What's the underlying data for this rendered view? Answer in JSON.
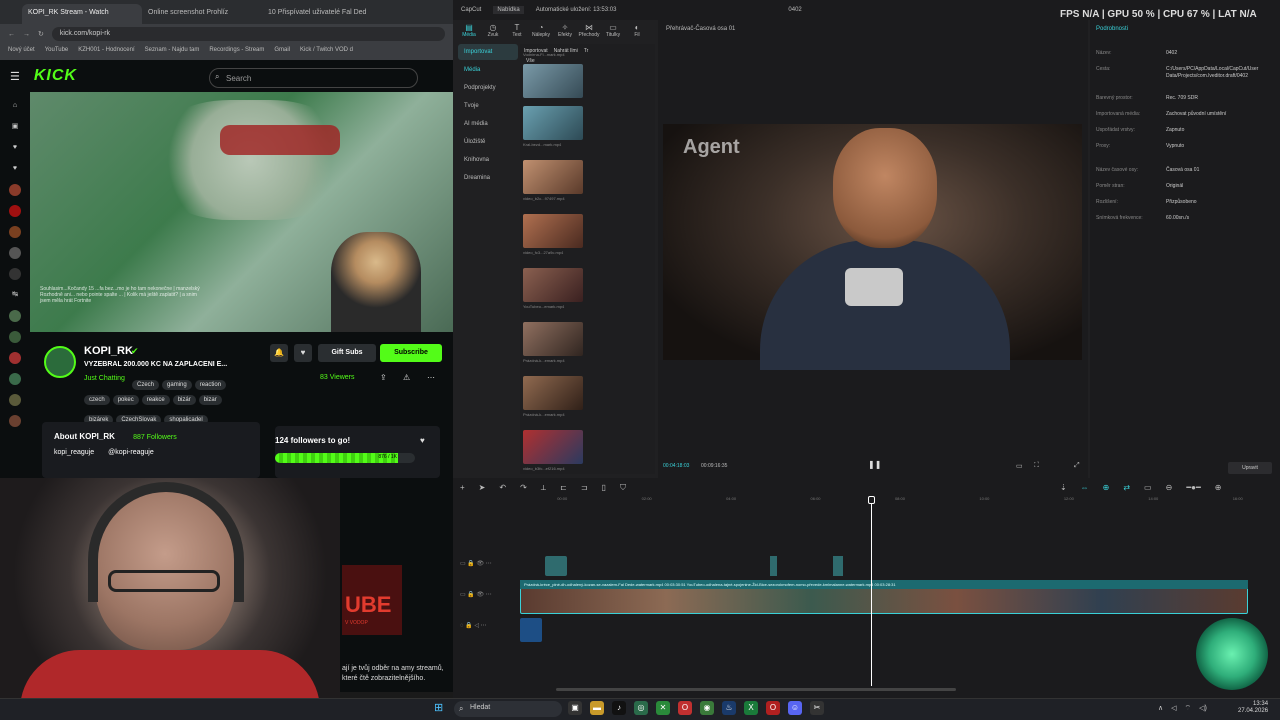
{
  "browser": {
    "tabs": [
      "KOPI_RK Stream - Watch",
      "Online screenshot Prohlíz",
      "10 Přispívatel uživatelé Fal Ded"
    ],
    "url": "kick.com/kopi-rk",
    "bookmarks": [
      "Nový účet",
      "YouTube",
      "KZH001 - Hodnocení",
      "Seznam - Najdu tam",
      "Recordings - Stream",
      "Gmail",
      "Kick / Twitch VOD d"
    ]
  },
  "kick": {
    "logo": "KICK",
    "search_placeholder": "Search",
    "channel_name": "KOPI_RK",
    "stream_title": "VYŽEBRAL 200.000 KČ NA ZAPLACENÍ E...",
    "category": "Just Chatting",
    "tags": [
      "Czech",
      "gaming",
      "reaction",
      "czech",
      "pokec",
      "reakce",
      "bizár",
      "bizar",
      "bizárek",
      "CzechSlovak",
      "shopalicadel"
    ],
    "gift_subs": "Gift Subs",
    "subscribe": "Subscribe",
    "viewers": "83 Viewers",
    "about_title": "About KOPI_RK",
    "followers": "887 Followers",
    "social_1": "kopi_reaguje",
    "social_2": "@kopi-reaguje",
    "followers_goal": "124 followers to go!",
    "goal_progress_text": "876 / 1K",
    "goal_fraction": 0.876,
    "chat_overlay": "Souhlasim...Kočandy 15 ...fa bez...mo je ho tam nekonečne | manzelský Rozhodně ani... nebo pointe spalte ... | Kolik má ještě zaplatit? | a snim jsem měla hrát Fortnite"
  },
  "promo": {
    "big_text": "UBE",
    "small_text": "V VODOP",
    "bottom_text": "ají je tvůj odběr na amy streamů, které čtě zobrazitelnějšího."
  },
  "capcut": {
    "app_name": "CapCut",
    "menu": "Nabídka",
    "autosave": "Automatické uložení: 13:53:03",
    "project_name": "0402",
    "osd": "FPS N/A | GPU 50 % | CPU 67 % | LAT N/A",
    "tools": [
      "Média",
      "Zvuk",
      "Text",
      "Nálepky",
      "Efekty",
      "Přechody",
      "Titulky",
      "Fil"
    ],
    "library": [
      "Importovat",
      "Média",
      "Podprojekty",
      "Tvoje",
      "AI média",
      "Úložiště",
      "Knihovna",
      "Dreamina"
    ],
    "media_tabs": [
      "Importovat",
      "Nahrát Ilmi",
      "Tr"
    ],
    "media_all": "Vše",
    "media_files": [
      "Vodnirna-Fl...mark.mp4",
      "Kral-bezd...mark.mp4",
      "video_b2c...97497.mp4",
      "video_fc3...27a9c.mp4",
      "YouTubeo...emark.mp4",
      "Prázdná-k...emark.mp4",
      "Prázdná-k...emark.mp4",
      "video_b3fc...ef216.mp4"
    ],
    "preview_title": "Přehrávač-Časová osa 01",
    "watermark": "Agent",
    "current_time": "00:04:18:03",
    "duration": "00:09:16:35",
    "details_header": "Podrobnosti",
    "details": [
      {
        "k": "Název:",
        "v": "0402"
      },
      {
        "k": "Cesta:",
        "v": "C:/Users/PC/AppData/Local/CapCut/User Data/Projects/com.lveditor.draft/0402"
      },
      {
        "k": "Barevný prostor:",
        "v": "Rec. 709 SDR"
      },
      {
        "k": "Importovaná média:",
        "v": "Zachovat původní umístění"
      },
      {
        "k": "Uspořádat vrstvy:",
        "v": "Zapnuto"
      },
      {
        "k": "Proxy:",
        "v": "Vypnuto"
      },
      {
        "k": "Název časové osy:",
        "v": "Časová osa 01"
      },
      {
        "k": "Poměr stran:",
        "v": "Originál"
      },
      {
        "k": "Rozlišení:",
        "v": "Přizpůsobeno"
      },
      {
        "k": "Snímková frekvence:",
        "v": "60.00sn./s"
      }
    ],
    "modify_button": "Upravit",
    "track_label": "Prázdná-kréce_plné-dh-odhalený-kozan-se-vazalem-Fal Dede-watermark.mp4   00:03:30:51      YouTubeo-odhalena-tajné-spojenine-Žid-Bice-sezorokmofem-nomo-převede-kmlmalanne-watermark.mp4  00:03:28:31",
    "ruler": [
      "00:00",
      "02:00",
      "04:00",
      "06:00",
      "08:00",
      "10:00",
      "12:00",
      "14:00",
      "16:00"
    ]
  },
  "taskbar": {
    "search": "Hledat",
    "time": "13:34",
    "date": "27.04.2026"
  }
}
